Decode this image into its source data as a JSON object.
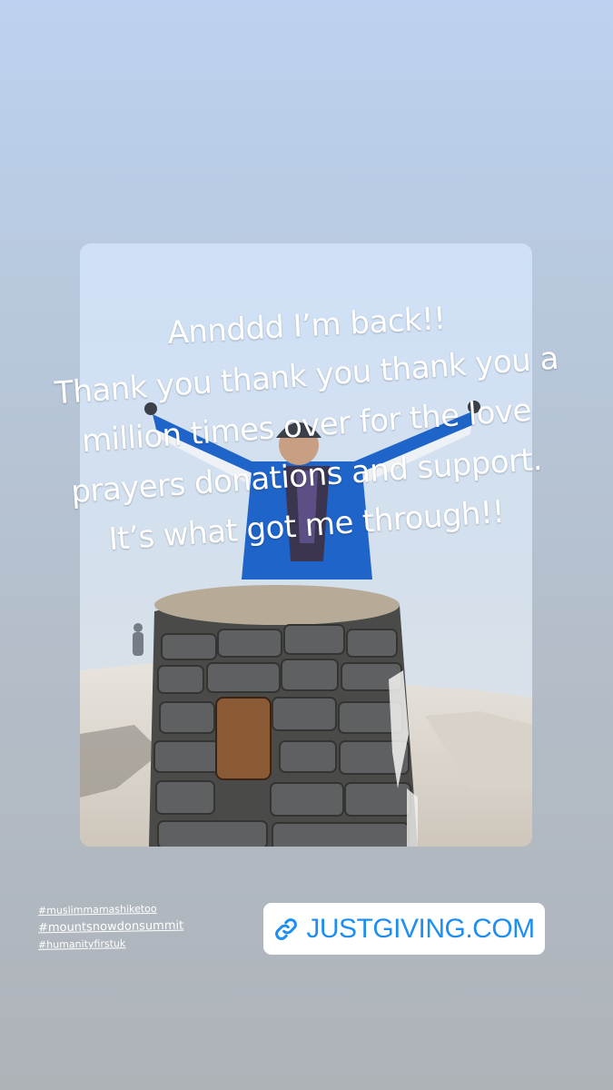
{
  "caption": {
    "lines": [
      "Annddd I’m back!!",
      "Thank you thank you thank you a",
      "million times over for the love",
      "prayers donations and support.",
      "It’s what got me through!!"
    ]
  },
  "hashtags": [
    "#muslimmamashiketoo",
    "#mountsnowdonsummit",
    "#humanityfirstuk"
  ],
  "link_sticker": {
    "icon": "link-icon",
    "label": "JUSTGIVING.COM",
    "color": "#1e8ef1"
  },
  "colors": {
    "background_top": "#bcd2f0",
    "background_bottom": "#aeb3b8",
    "jacket": "#1f64c9"
  }
}
